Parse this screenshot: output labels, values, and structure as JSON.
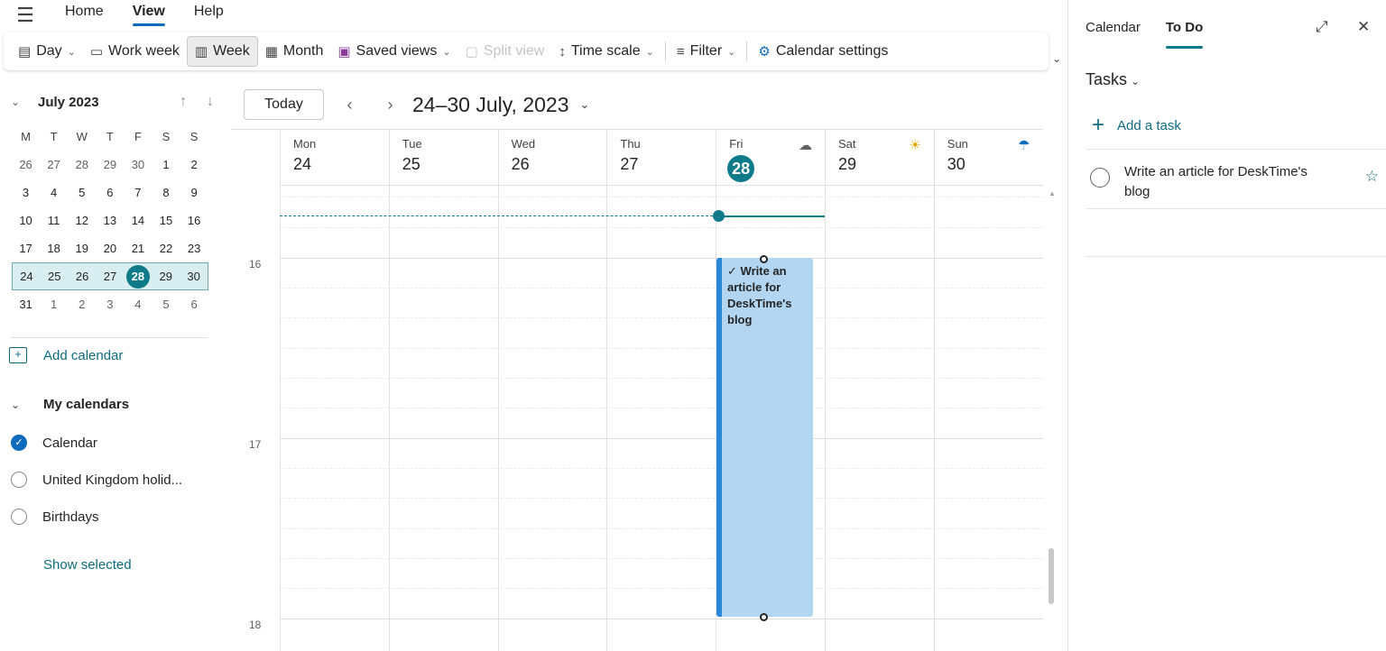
{
  "topnav": {
    "tabs": [
      "Home",
      "View",
      "Help"
    ],
    "active": "View"
  },
  "ribbon": {
    "day": "Day",
    "work_week": "Work week",
    "week": "Week",
    "month": "Month",
    "saved_views": "Saved views",
    "split_view": "Split view",
    "time_scale": "Time scale",
    "filter": "Filter",
    "calendar_settings": "Calendar settings"
  },
  "mini_calendar": {
    "month_label": "July 2023",
    "weekday_heads": [
      "M",
      "T",
      "W",
      "T",
      "F",
      "S",
      "S"
    ],
    "weeks": [
      [
        "26",
        "27",
        "28",
        "29",
        "30",
        "1",
        "2"
      ],
      [
        "3",
        "4",
        "5",
        "6",
        "7",
        "8",
        "9"
      ],
      [
        "10",
        "11",
        "12",
        "13",
        "14",
        "15",
        "16"
      ],
      [
        "17",
        "18",
        "19",
        "20",
        "21",
        "22",
        "23"
      ],
      [
        "24",
        "25",
        "26",
        "27",
        "28",
        "29",
        "30"
      ],
      [
        "31",
        "1",
        "2",
        "3",
        "4",
        "5",
        "6"
      ]
    ],
    "today": "28"
  },
  "sidebar": {
    "add_calendar": "Add calendar",
    "my_calendars": "My calendars",
    "calendars": [
      {
        "label": "Calendar",
        "checked": true
      },
      {
        "label": "United Kingdom holid...",
        "checked": false
      },
      {
        "label": "Birthdays",
        "checked": false
      }
    ],
    "show_selected": "Show selected"
  },
  "main": {
    "today_button": "Today",
    "date_range": "24–30 July, 2023",
    "days": [
      {
        "name": "Mon",
        "date": "24"
      },
      {
        "name": "Tue",
        "date": "25"
      },
      {
        "name": "Wed",
        "date": "26"
      },
      {
        "name": "Thu",
        "date": "27"
      },
      {
        "name": "Fri",
        "date": "28",
        "weather": "cloud-icon",
        "today": true
      },
      {
        "name": "Sat",
        "date": "29",
        "weather": "sun-icon"
      },
      {
        "name": "Sun",
        "date": "30",
        "weather": "rain-cloud-icon"
      }
    ],
    "hours": [
      "16",
      "17",
      "18"
    ],
    "event": {
      "title": "Write an article for DeskTime's blog",
      "day": "Fri"
    }
  },
  "right_pane": {
    "tabs": [
      "Calendar",
      "To Do"
    ],
    "active_tab": "To Do",
    "tasks_heading": "Tasks",
    "add_task": "Add a task",
    "task_items": [
      {
        "title": "Write an article for DeskTime's blog"
      }
    ]
  },
  "colors": {
    "accent": "#0e7a8a",
    "brand_blue": "#0f6cbd",
    "event_fill": "#b2d6f2",
    "event_bar": "#2b88d8"
  }
}
